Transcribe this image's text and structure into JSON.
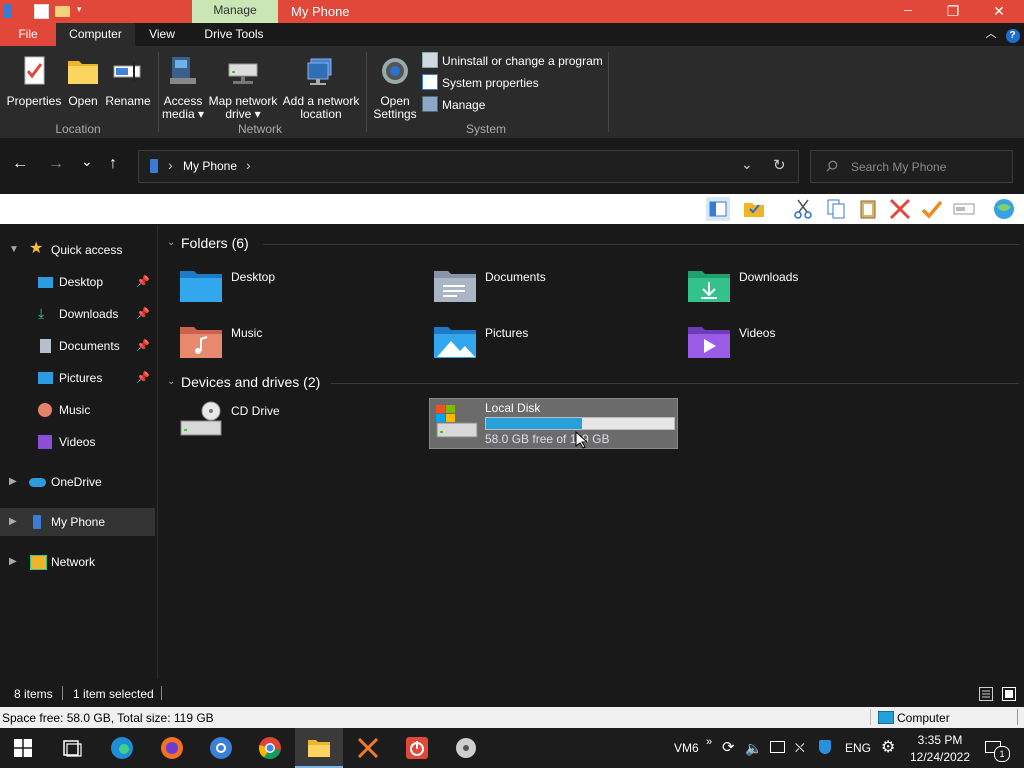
{
  "titlebar": {
    "context_tab": "Manage",
    "title": "My Phone",
    "minimize": "─",
    "maximize": "❐",
    "close": "✕"
  },
  "ribbon_tabs": {
    "file": "File",
    "computer": "Computer",
    "view": "View",
    "drive_tools": "Drive Tools",
    "collapse": "︿",
    "help": "?"
  },
  "ribbon": {
    "location": {
      "label": "Location",
      "properties": "Properties",
      "open": "Open",
      "rename": "Rename"
    },
    "network": {
      "label": "Network",
      "access_media_1": "Access",
      "access_media_2": "media ▾",
      "map_drive_1": "Map network",
      "map_drive_2": "drive ▾",
      "add_location_1": "Add a network",
      "add_location_2": "location"
    },
    "system": {
      "label": "System",
      "open_settings_1": "Open",
      "open_settings_2": "Settings",
      "uninstall": "Uninstall or change a program",
      "system_properties": "System properties",
      "manage": "Manage"
    }
  },
  "nav": {
    "back": "←",
    "forward": "→",
    "recent": "⌄",
    "up": "↑",
    "breadcrumb_item": "My Phone",
    "sep": "›",
    "dropdown": "⌄",
    "refresh": "↻",
    "search_placeholder": "Search My Phone"
  },
  "navpane": {
    "quick_access": "Quick access",
    "items": [
      {
        "label": "Desktop",
        "pin": "📌"
      },
      {
        "label": "Downloads",
        "pin": "📌"
      },
      {
        "label": "Documents",
        "pin": "📌"
      },
      {
        "label": "Pictures",
        "pin": "📌"
      },
      {
        "label": "Music"
      },
      {
        "label": "Videos"
      }
    ],
    "onedrive": "OneDrive",
    "my_phone": "My Phone",
    "network": "Network"
  },
  "content": {
    "folders_header": "Folders (6)",
    "folders": [
      "Desktop",
      "Documents",
      "Downloads",
      "Music",
      "Pictures",
      "Videos"
    ],
    "devices_header": "Devices and drives (2)",
    "cd_drive": "CD Drive",
    "local_disk": {
      "name": "Local Disk",
      "free_text": "58.0 GB free of 119 GB",
      "used_fraction": 0.51
    }
  },
  "statusbar": {
    "items": "8 items",
    "selected": "1 item selected"
  },
  "infobar": {
    "space": "Space free: 58.0 GB, Total size: 119 GB",
    "computer": "Computer"
  },
  "taskbar": {
    "vm": "VM6",
    "chevron": "»",
    "lang": "ENG",
    "time": "3:35 PM",
    "date": "12/24/2022",
    "notif_count": "1"
  }
}
